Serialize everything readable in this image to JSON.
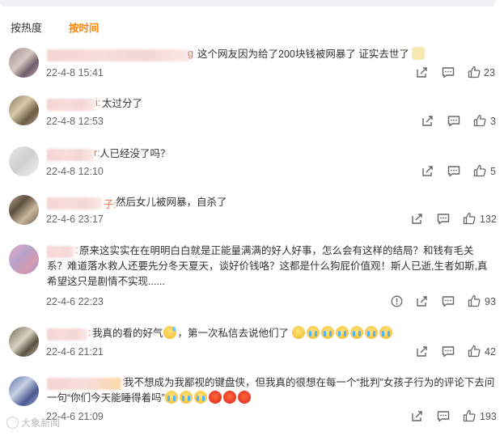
{
  "sort": {
    "hot": "按热度",
    "time": "按时间"
  },
  "comments": [
    {
      "name_tail": "g",
      "text": "这个网友因为给了200块钱被网暴了 证实去世了",
      "time": "22-4-8 15:41",
      "likes": "23"
    },
    {
      "name_tail": "i:",
      "text": "太过分了",
      "time": "22-4-8 12:53",
      "likes": "3"
    },
    {
      "name_tail": "r:",
      "text": "人已经没了吗？",
      "time": "22-4-8 12:10",
      "likes": "5"
    },
    {
      "name_tail": "子:",
      "text": "然后女儿被网暴，自杀了",
      "time": "22-4-6 23:17",
      "likes": "132"
    },
    {
      "name_tail": ":",
      "text": "原来这实实在在明明白白就是正能量满满的好人好事，怎么会有这样的结局？和钱有毛关系？难道落水救人还要先分冬天夏天，谈好价钱咯？这都是什么狗屁价值观！斯人已逝,生者如斯,真希望这只是剧情不实现......",
      "time": "22-4-6 22:23",
      "likes": "93"
    },
    {
      "name_tail": ":",
      "text": "我真的看的好气",
      "text2": "，第一次私信去说他们了",
      "time": "22-4-6 21:21",
      "likes": "42"
    },
    {
      "name_tail": ":",
      "text": "我不想成为我鄙视的键盘侠，但我真的很想在每一个“批判”女孩子行为的评论下去问一句“你们今天能睡得着吗”",
      "time": "22-4-6 21:09",
      "likes": "193"
    }
  ],
  "watermark": "大象新闻",
  "icons": {
    "share": "share-icon",
    "comment": "comment-icon",
    "like": "like-icon"
  },
  "colors": {
    "accent": "#ff8200",
    "name": "#eb7350"
  }
}
